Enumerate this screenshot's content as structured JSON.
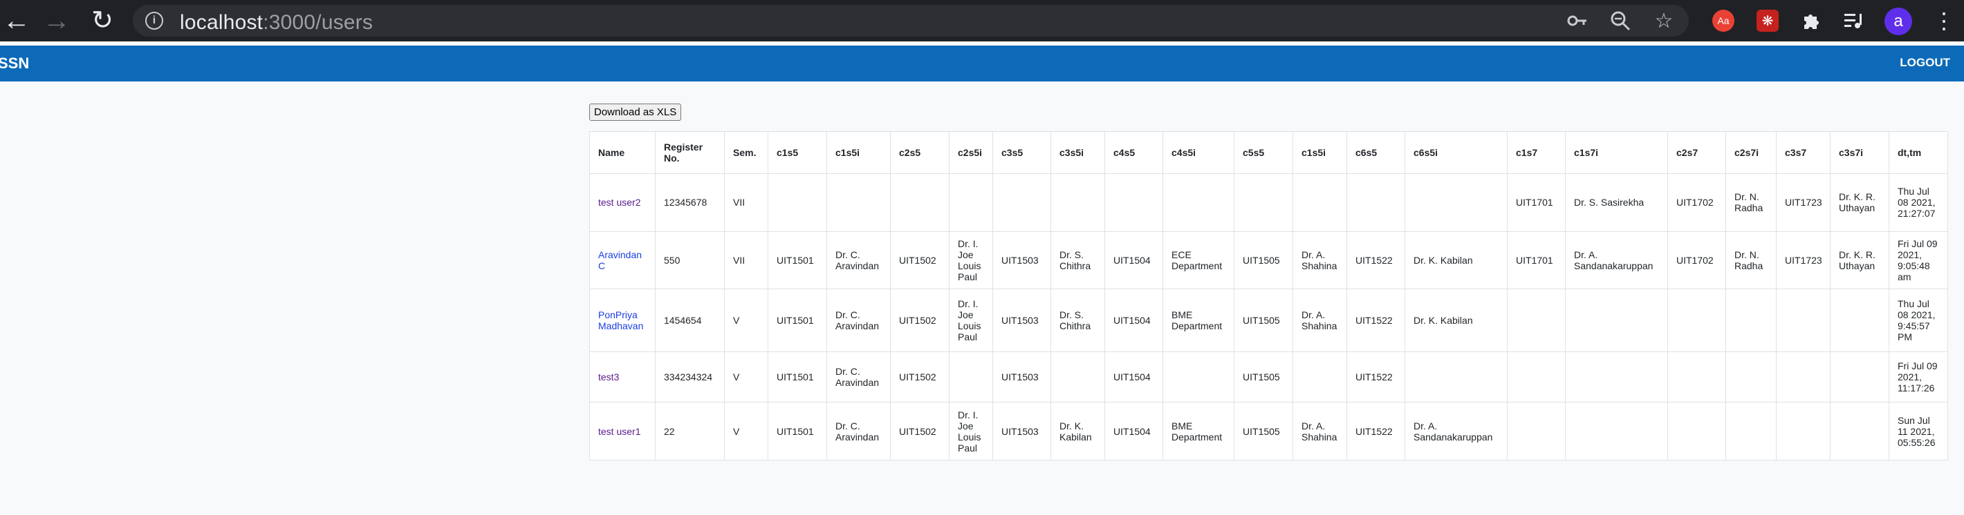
{
  "browser": {
    "url_host": "localhost",
    "url_path": ":3000/users",
    "avatar_letter": "a",
    "ext_badge": "Aa"
  },
  "navbar": {
    "brand": "SSN",
    "logout": "LOGOUT"
  },
  "download_label": "Download as XLS",
  "table": {
    "headers": [
      "Name",
      "Register No.",
      "Sem.",
      "c1s5",
      "c1s5i",
      "c2s5",
      "c2s5i",
      "c3s5",
      "c3s5i",
      "c4s5",
      "c4s5i",
      "c5s5",
      "c1s5i",
      "c6s5",
      "c6s5i",
      "c1s7",
      "c1s7i",
      "c2s7",
      "c2s7i",
      "c3s7",
      "c3s7i",
      "dt,tm"
    ],
    "rows": [
      {
        "name": "test user2",
        "link_state": "visited",
        "cells": [
          "12345678",
          "VII",
          "",
          "",
          "",
          "",
          "",
          "",
          "",
          "",
          "",
          "",
          "",
          "",
          "UIT1701",
          "Dr. S. Sasirekha",
          "UIT1702",
          "Dr. N. Radha",
          "UIT1723",
          "Dr. K. R. Uthayan",
          "Thu Jul 08 2021, 21:27:07"
        ]
      },
      {
        "name": "Aravindan C",
        "link_state": "unvisited",
        "cells": [
          "550",
          "VII",
          "UIT1501",
          "Dr. C. Aravindan",
          "UIT1502",
          "Dr. I. Joe Louis Paul",
          "UIT1503",
          "Dr. S. Chithra",
          "UIT1504",
          "ECE Department",
          "UIT1505",
          "Dr. A. Shahina",
          "UIT1522",
          "Dr. K. Kabilan",
          "UIT1701",
          "Dr. A. Sandanakaruppan",
          "UIT1702",
          "Dr. N. Radha",
          "UIT1723",
          "Dr. K. R. Uthayan",
          "Fri Jul 09 2021, 9:05:48 am"
        ]
      },
      {
        "name": "PonPriya Madhavan",
        "link_state": "unvisited",
        "cells": [
          "1454654",
          "V",
          "UIT1501",
          "Dr. C. Aravindan",
          "UIT1502",
          "Dr. I. Joe Louis Paul",
          "UIT1503",
          "Dr. S. Chithra",
          "UIT1504",
          "BME Department",
          "UIT1505",
          "Dr. A. Shahina",
          "UIT1522",
          "Dr. K. Kabilan",
          "",
          "",
          "",
          "",
          "",
          "",
          "Thu Jul 08 2021, 9:45:57 PM"
        ]
      },
      {
        "name": "test3",
        "link_state": "visited",
        "cells": [
          "334234324",
          "V",
          "UIT1501",
          "Dr. C. Aravindan",
          "UIT1502",
          "",
          "UIT1503",
          "",
          "UIT1504",
          "",
          "UIT1505",
          "",
          "UIT1522",
          "",
          "",
          "",
          "",
          "",
          "",
          "",
          "Fri Jul 09 2021, 11:17:26"
        ]
      },
      {
        "name": "test user1",
        "link_state": "visited",
        "cells": [
          "22",
          "V",
          "UIT1501",
          "Dr. C. Aravindan",
          "UIT1502",
          "Dr. I. Joe Louis Paul",
          "UIT1503",
          "Dr. K. Kabilan",
          "UIT1504",
          "BME Department",
          "UIT1505",
          "Dr. A. Shahina",
          "UIT1522",
          "Dr. A. Sandanakaruppan",
          "",
          "",
          "",
          "",
          "",
          "",
          "Sun Jul 11 2021, 05:55:26"
        ]
      }
    ]
  }
}
